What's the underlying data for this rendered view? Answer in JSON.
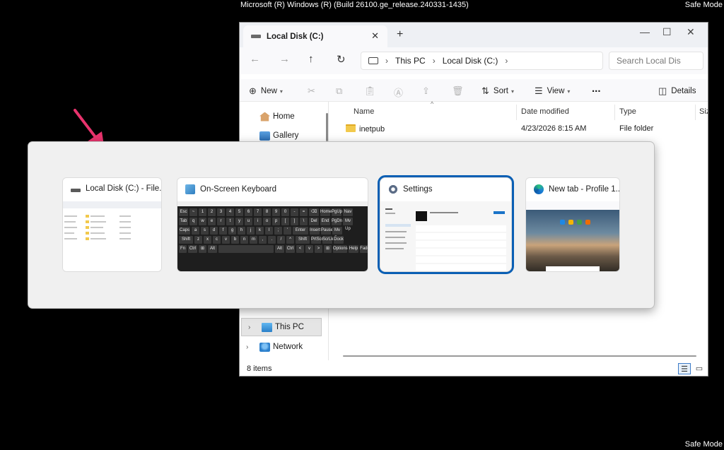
{
  "system": {
    "build_text": "Microsoft (R) Windows (R) (Build 26100.ge_release.240331-1435)",
    "safe_mode": "Safe Mode"
  },
  "explorer": {
    "tab_title": "Local Disk (C:)",
    "address": {
      "segments": [
        "This PC",
        "Local Disk (C:)"
      ]
    },
    "search_placeholder": "Search Local Dis",
    "commands": {
      "new": "New",
      "sort": "Sort",
      "view": "View",
      "more": "...",
      "details": "Details"
    },
    "nav": {
      "home": "Home",
      "gallery": "Gallery",
      "this_pc": "This PC",
      "network": "Network"
    },
    "columns": {
      "name": "Name",
      "date_modified": "Date modified",
      "type": "Type",
      "size": "Siz"
    },
    "rows": [
      {
        "name": "inetpub",
        "date": "4/23/2026 8:15 AM",
        "type": "File folder"
      }
    ],
    "status": "8 items"
  },
  "switcher": {
    "windows": [
      {
        "title": "Local Disk (C:) - File...",
        "icon": "drive-icon"
      },
      {
        "title": "On-Screen Keyboard",
        "icon": "keyboard-icon"
      },
      {
        "title": "Settings",
        "icon": "gear-icon"
      },
      {
        "title": "New tab - Profile 1...",
        "icon": "edge-icon"
      }
    ],
    "selected_index": 2
  },
  "colors": {
    "selection": "#0a5fb4",
    "accent_arrow": "#e8336d"
  }
}
